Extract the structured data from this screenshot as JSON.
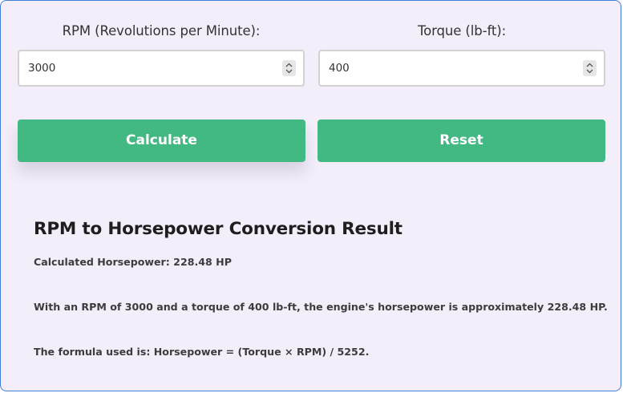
{
  "form": {
    "rpm_label": "RPM (Revolutions per Minute):",
    "rpm_value": "3000",
    "torque_label": "Torque (lb-ft):",
    "torque_value": "400"
  },
  "buttons": {
    "calculate_label": "Calculate",
    "reset_label": "Reset"
  },
  "result": {
    "title": "RPM to Horsepower Conversion Result",
    "horsepower_line": "Calculated Horsepower: 228.48 HP",
    "summary_line": "With an RPM of 3000 and a torque of 400 lb-ft, the engine's horsepower is approximately 228.48 HP.",
    "formula_line": "The formula used is: Horsepower = (Torque × RPM) / 5252."
  },
  "colors": {
    "accent": "#42b883",
    "background": "#f4eefb",
    "border": "#3f7fd9"
  },
  "icons": {
    "stepper": "spin-button-icon"
  }
}
